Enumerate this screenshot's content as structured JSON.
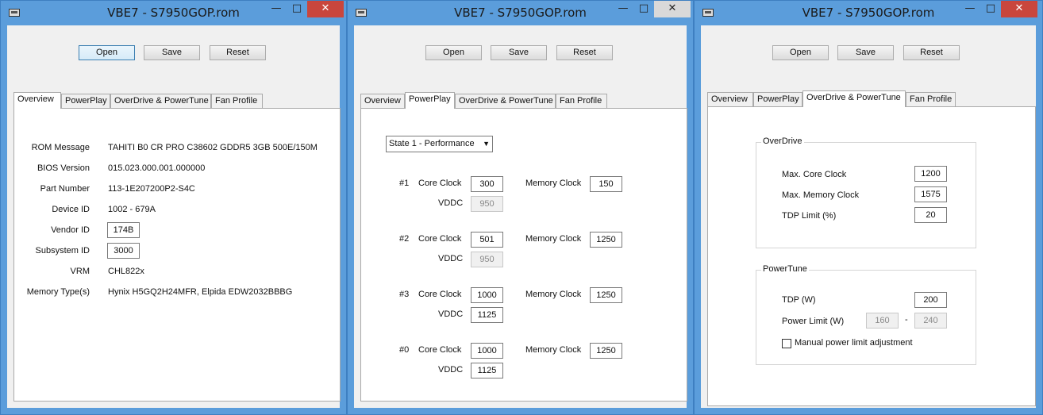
{
  "windows": [
    {
      "title": "VBE7 - S7950GOP.rom",
      "controls": {
        "minimize": "—",
        "maximize": "□",
        "close": "✕"
      },
      "buttons": {
        "open": "Open",
        "save": "Save",
        "reset": "Reset"
      },
      "tabs": [
        "Overview",
        "PowerPlay",
        "OverDrive & PowerTune",
        "Fan Profile"
      ],
      "active_tab": "Overview",
      "overview": {
        "rom_message_label": "ROM Message",
        "rom_message": "TAHITI B0 CR PRO C38602 GDDR5 3GB 500E/150M",
        "bios_version_label": "BIOS Version",
        "bios_version": "015.023.000.001.000000",
        "part_number_label": "Part Number",
        "part_number": "113-1E207200P2-S4C",
        "device_id_label": "Device ID",
        "device_id": "1002 - 679A",
        "vendor_id_label": "Vendor ID",
        "vendor_id": "174B",
        "subsystem_id_label": "Subsystem ID",
        "subsystem_id": "3000",
        "vrm_label": "VRM",
        "vrm": "CHL822x",
        "memory_type_label": "Memory Type(s)",
        "memory_type": "Hynix H5GQ2H24MFR, Elpida EDW2032BBBG"
      }
    },
    {
      "title": "VBE7 - S7950GOP.rom",
      "controls": {
        "minimize": "—",
        "maximize": "□",
        "close": "✕"
      },
      "buttons": {
        "open": "Open",
        "save": "Save",
        "reset": "Reset"
      },
      "tabs": [
        "Overview",
        "PowerPlay",
        "OverDrive & PowerTune",
        "Fan Profile"
      ],
      "active_tab": "PowerPlay",
      "powerplay": {
        "state_select": "State 1 - Performance",
        "core_clock_label": "Core Clock",
        "memory_clock_label": "Memory Clock",
        "vddc_label": "VDDC",
        "states": [
          {
            "id": "#1",
            "core": "300",
            "memory": "150",
            "vddc": "950",
            "vddc_disabled": true
          },
          {
            "id": "#2",
            "core": "501",
            "memory": "1250",
            "vddc": "950",
            "vddc_disabled": true
          },
          {
            "id": "#3",
            "core": "1000",
            "memory": "1250",
            "vddc": "1125",
            "vddc_disabled": false
          },
          {
            "id": "#0",
            "core": "1000",
            "memory": "1250",
            "vddc": "1125",
            "vddc_disabled": false
          }
        ]
      }
    },
    {
      "title": "VBE7 - S7950GOP.rom",
      "controls": {
        "minimize": "—",
        "maximize": "□",
        "close": "✕"
      },
      "buttons": {
        "open": "Open",
        "save": "Save",
        "reset": "Reset"
      },
      "tabs": [
        "Overview",
        "PowerPlay",
        "OverDrive & PowerTune",
        "Fan Profile"
      ],
      "active_tab": "OverDrive & PowerTune",
      "overdrive": {
        "group_title": "OverDrive",
        "max_core_clock_label": "Max. Core Clock",
        "max_core_clock": "1200",
        "max_memory_clock_label": "Max. Memory Clock",
        "max_memory_clock": "1575",
        "tdp_limit_label": "TDP Limit (%)",
        "tdp_limit": "20"
      },
      "powertune": {
        "group_title": "PowerTune",
        "tdp_label": "TDP (W)",
        "tdp": "200",
        "power_limit_label": "Power Limit (W)",
        "power_limit_min": "160",
        "power_limit_sep": "-",
        "power_limit_max": "240",
        "manual_limit_label": "Manual power limit adjustment",
        "manual_limit_checked": false
      }
    }
  ]
}
